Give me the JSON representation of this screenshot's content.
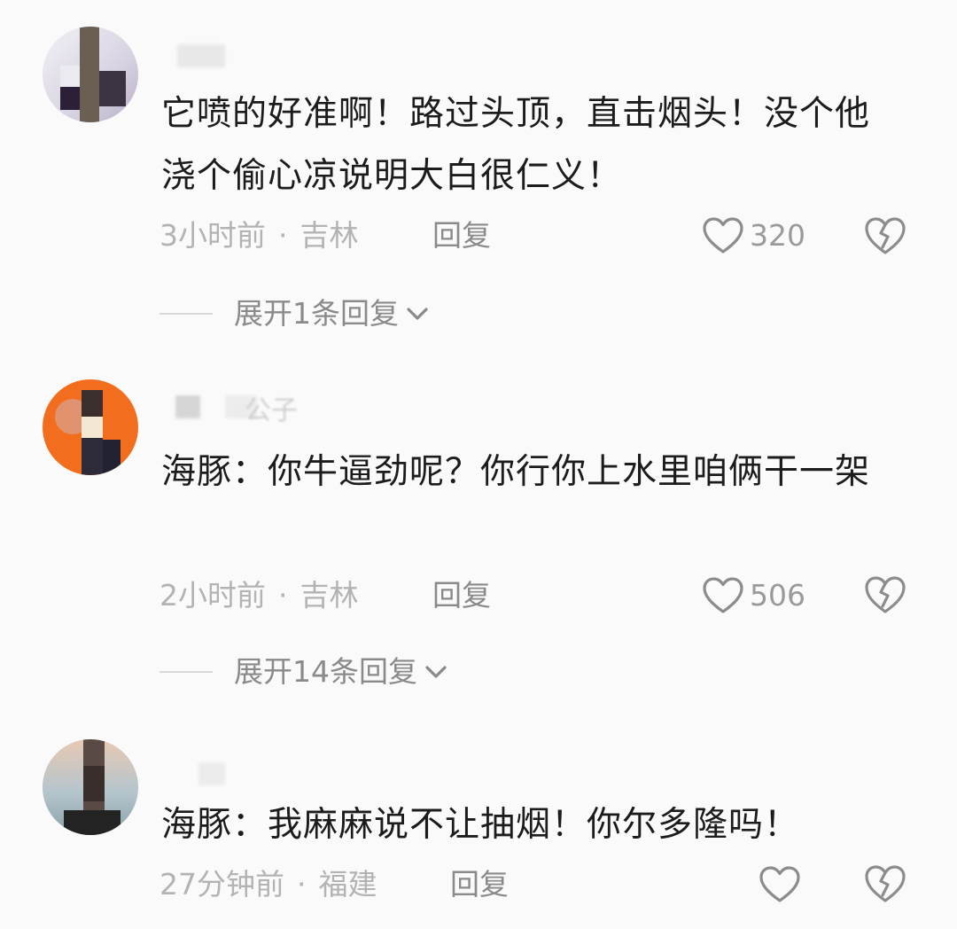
{
  "comments": [
    {
      "text": "它喷的好准啊！路过头顶，直击烟头！没个他浇个偷心凉说明大白很仁义！",
      "time": "3小时前",
      "location": "吉林",
      "reply_label": "回复",
      "likes": "320",
      "expand_label": "展开1条回复"
    },
    {
      "username_fragment": "公子",
      "text": "海豚：你牛逼劲呢？你行你上水里咱俩干一架",
      "time": "2小时前",
      "location": "吉林",
      "reply_label": "回复",
      "likes": "506",
      "expand_label": "展开14条回复"
    },
    {
      "text": "海豚：我麻麻说不让抽烟！你尔多隆吗！",
      "time": "27分钟前",
      "location": "福建",
      "reply_label": "回复",
      "likes": ""
    }
  ],
  "meta_separator": "·",
  "icons": {
    "like": "heart-outline-icon",
    "dislike": "broken-heart-icon",
    "expand": "chevron-down-icon"
  },
  "colors": {
    "background": "#fafafa",
    "text": "#1c1c1c",
    "meta": "#b3b3b3",
    "action": "#8a8a8a",
    "avatar2_bg": "#f26d1d"
  }
}
